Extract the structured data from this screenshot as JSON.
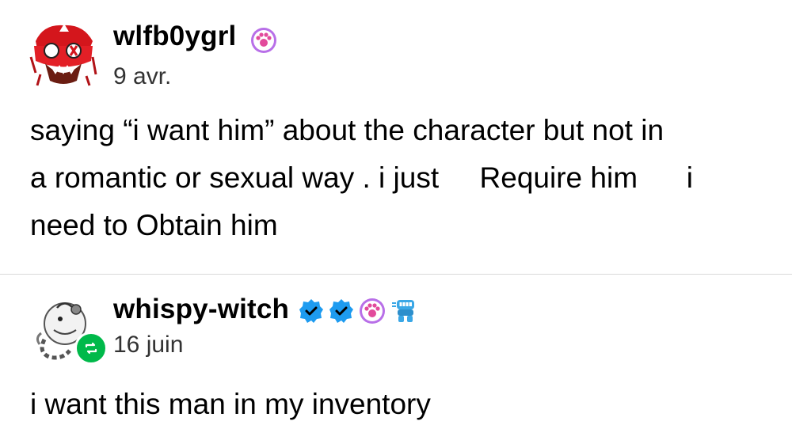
{
  "posts": [
    {
      "username": "wlfb0ygrl",
      "date": "9 avr.",
      "lines": [
        "saying “i want him” about the character but not in",
        "a romantic or sexual way . i just     Require him      i",
        "need to Obtain him"
      ],
      "badges": [
        "paw-badge-icon"
      ]
    },
    {
      "username": "whispy-witch",
      "date": "16 juin",
      "lines": [
        "i want this man in my inventory"
      ],
      "badges": [
        "verified-badge-icon",
        "verified-badge-icon",
        "paw-badge-icon",
        "teeth-badge-icon"
      ]
    }
  ],
  "colors": {
    "verified": "#1d9bf0",
    "paw": "#9b59d6",
    "reblog": "#00b94a",
    "divider": "#d9d9d9"
  }
}
